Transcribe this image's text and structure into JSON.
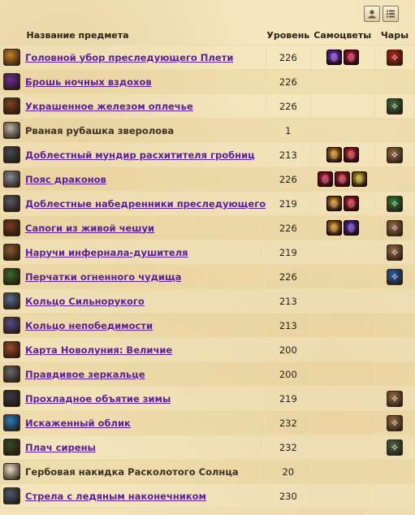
{
  "header": {
    "name": "Название предмета",
    "level": "Уровень",
    "gems": "Самоцветы",
    "enchants": "Чары"
  },
  "toolbar": {
    "icons": [
      "character-view-icon",
      "list-view-icon"
    ]
  },
  "items": [
    {
      "name": "Головной убор преследующего Плети",
      "level": "226",
      "link": true,
      "icon_color": "#c7802a",
      "gems": [
        "#7a2fd9",
        "#c8163a"
      ],
      "ench": "#b8241b"
    },
    {
      "name": "Брошь ночных вздохов",
      "level": "226",
      "link": true,
      "icon_color": "#6b2d91",
      "gems": [],
      "ench": null
    },
    {
      "name": "Укрaшенное железом оплечье",
      "level": "226",
      "link": true,
      "icon_color": "#7a4422",
      "gems": [],
      "ench": "#3f6b3f"
    },
    {
      "name": "Рваная рубашка зверолова",
      "level": "1",
      "link": false,
      "icon_color": "#b9b0a0",
      "gems": [],
      "ench": null
    },
    {
      "name": "Доблестный мундир расхитителя гробниц",
      "level": "213",
      "link": true,
      "icon_color": "#4a4a52",
      "gems": [
        "#d98a12",
        "#d41f2e"
      ],
      "ench": "#9a6b4a"
    },
    {
      "name": "Пояс драконов",
      "level": "226",
      "link": true,
      "icon_color": "#8a8a94",
      "gems": [
        "#c8163a",
        "#d41f2e",
        "#d0b014"
      ],
      "ench": null
    },
    {
      "name": "Доблестные набедренники преследующего",
      "level": "219",
      "link": true,
      "icon_color": "#5a5a64",
      "gems": [
        "#d98a12",
        "#d41f2e"
      ],
      "ench": "#2f7a34"
    },
    {
      "name": "Сапоги из живой чешуи",
      "level": "226",
      "link": true,
      "icon_color": "#7a3a1e",
      "gems": [
        "#d98a12",
        "#5a2ab8"
      ],
      "ench": "#9a6b4a"
    },
    {
      "name": "Наручи инфернала-душителя",
      "level": "219",
      "link": true,
      "icon_color": "#8a5a2a",
      "gems": [],
      "ench": "#9a6b4a"
    },
    {
      "name": "Перчатки огненного чудища",
      "level": "226",
      "link": true,
      "icon_color": "#3a6b2a",
      "gems": [],
      "ench": "#2b5fa8"
    },
    {
      "name": "Кольцо Сильнорукого",
      "level": "213",
      "link": true,
      "icon_color": "#5a6a8a",
      "gems": [],
      "ench": null
    },
    {
      "name": "Кольцо непобедимости",
      "level": "213",
      "link": true,
      "icon_color": "#5a4a8a",
      "gems": [],
      "ench": null
    },
    {
      "name": "Карта Новолуния: Величие",
      "level": "200",
      "link": true,
      "icon_color": "#9a4a2a",
      "gems": [],
      "ench": null
    },
    {
      "name": "Правдивое зеркальце",
      "level": "200",
      "link": true,
      "icon_color": "#6a6a6a",
      "gems": [],
      "ench": null
    },
    {
      "name": "Прохладное объятие зимы",
      "level": "219",
      "link": true,
      "icon_color": "#3a3a44",
      "gems": [],
      "ench": "#9a6b4a"
    },
    {
      "name": "Искаженный облик",
      "level": "232",
      "link": true,
      "icon_color": "#2a7ab8",
      "gems": [],
      "ench": "#9a6b4a"
    },
    {
      "name": "Плач сирены",
      "level": "232",
      "link": true,
      "icon_color": "#3a4a2a",
      "gems": [],
      "ench": "#4a6a4a"
    },
    {
      "name": "Гербовая накидка Расколотого Солнца",
      "level": "20",
      "link": false,
      "icon_color": "#e8dcc0",
      "gems": [],
      "ench": null
    },
    {
      "name": "Стрела с ледяным наконечником",
      "level": "230",
      "link": true,
      "icon_color": "#4a5a6a",
      "gems": [],
      "ench": null
    }
  ]
}
